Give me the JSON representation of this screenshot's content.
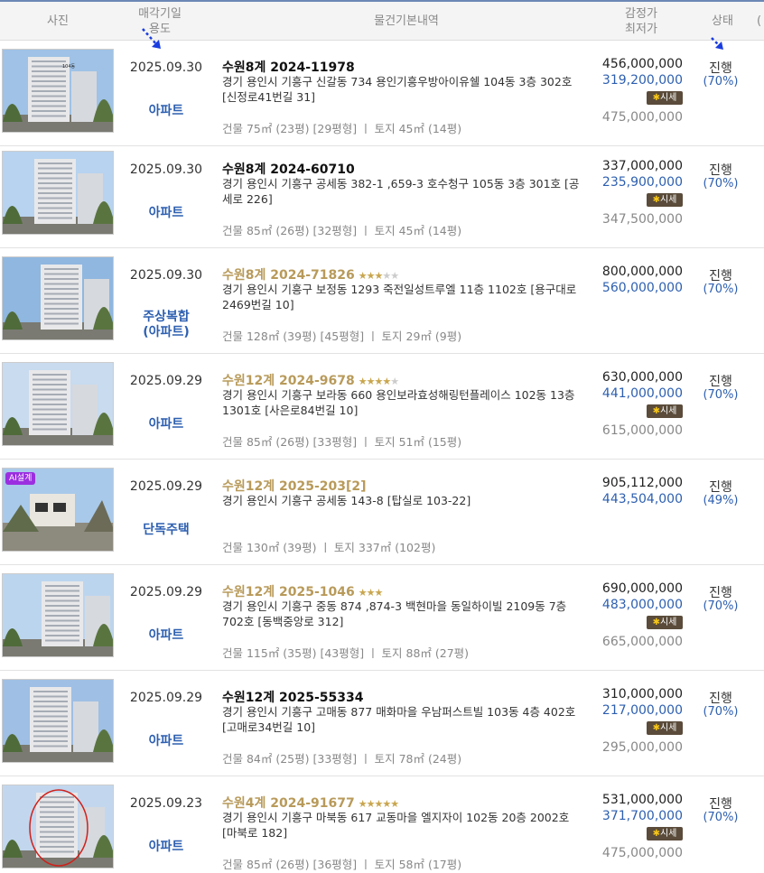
{
  "header": {
    "photo": "사진",
    "date": "매각기일",
    "usage": "용도",
    "info": "물건기본내역",
    "appraisal": "감정가",
    "min_price": "최저가",
    "status": "상태",
    "extra": "("
  },
  "rows": [
    {
      "date": "2025.09.30",
      "usage": "아파트",
      "case": "수원8계 2024-11978",
      "stars": 0,
      "case_style": "plain",
      "address": "경기 용인시 기흥구 신갈동 734 용인기흥우방아이유쉘 104동 3층 302호 [신정로41번길 31]",
      "area": "건물 75㎡ (23평) [29평형]  ㅣ  토지 45㎡ (14평)",
      "appraisal": "456,000,000",
      "min_price": "319,200,000",
      "sise": "시세",
      "market": "475,000,000",
      "status": "진행",
      "pct": "(70%)",
      "photo_label": "104동",
      "badge": ""
    },
    {
      "date": "2025.09.30",
      "usage": "아파트",
      "case": "수원8계 2024-60710",
      "stars": 0,
      "case_style": "plain",
      "address": "경기 용인시 기흥구 공세동 382-1 ,659-3 호수청구 105동 3층 301호 [공세로 226]",
      "area": "건물 85㎡ (26평) [32평형]  ㅣ  토지 45㎡ (14평)",
      "appraisal": "337,000,000",
      "min_price": "235,900,000",
      "sise": "시세",
      "market": "347,500,000",
      "status": "진행",
      "pct": "(70%)",
      "photo_label": "",
      "badge": ""
    },
    {
      "date": "2025.09.30",
      "usage": "주상복합\n(아파트)",
      "case": "수원8계 2024-71826",
      "stars": 3,
      "case_style": "gold",
      "address": "경기 용인시 기흥구 보정동 1293 죽전일성트루엘 11층 1102호 [용구대로2469번길 10]",
      "area": "건물 128㎡ (39평) [45평형]  ㅣ  토지 29㎡ (9평)",
      "appraisal": "800,000,000",
      "min_price": "560,000,000",
      "sise": "",
      "market": "",
      "status": "진행",
      "pct": "(70%)",
      "photo_label": "",
      "badge": ""
    },
    {
      "date": "2025.09.29",
      "usage": "아파트",
      "case": "수원12계 2024-9678",
      "stars": 4,
      "case_style": "gold",
      "address": "경기 용인시 기흥구 보라동 660 용인보라효성해링턴플레이스 102동 13층 1301호 [사은로84번길 10]",
      "area": "건물 85㎡ (26평) [33평형]  ㅣ  토지 51㎡ (15평)",
      "appraisal": "630,000,000",
      "min_price": "441,000,000",
      "sise": "시세",
      "market": "615,000,000",
      "status": "진행",
      "pct": "(70%)",
      "photo_label": "",
      "badge": ""
    },
    {
      "date": "2025.09.29",
      "usage": "단독주택",
      "case": "수원12계 2025-203[2]",
      "stars": 0,
      "case_style": "gold",
      "address": "경기 용인시 기흥구 공세동 143-8 [탑실로 103-22]",
      "area": "건물 130㎡ (39평)  ㅣ  토지 337㎡ (102평)",
      "appraisal": "905,112,000",
      "min_price": "443,504,000",
      "sise": "",
      "market": "",
      "status": "진행",
      "pct": "(49%)",
      "photo_label": "",
      "badge": "AI설계"
    },
    {
      "date": "2025.09.29",
      "usage": "아파트",
      "case": "수원12계 2025-1046",
      "stars": 2.5,
      "case_style": "gold",
      "address": "경기 용인시 기흥구 중동 874 ,874-3 백현마을 동일하이빌 2109동 7층 702호 [동백중앙로 312]",
      "area": "건물 115㎡ (35평) [43평형]  ㅣ  토지 88㎡ (27평)",
      "appraisal": "690,000,000",
      "min_price": "483,000,000",
      "sise": "시세",
      "market": "665,000,000",
      "status": "진행",
      "pct": "(70%)",
      "photo_label": "",
      "badge": ""
    },
    {
      "date": "2025.09.29",
      "usage": "아파트",
      "case": "수원12계 2025-55334",
      "stars": 0,
      "case_style": "plain",
      "address": "경기 용인시 기흥구 고매동 877 매화마을 우남퍼스트빌 103동 4층 402호 [고매로34번길 10]",
      "area": "건물 84㎡ (25평) [33평형]  ㅣ  토지 78㎡ (24평)",
      "appraisal": "310,000,000",
      "min_price": "217,000,000",
      "sise": "시세",
      "market": "295,000,000",
      "status": "진행",
      "pct": "(70%)",
      "photo_label": "",
      "badge": ""
    },
    {
      "date": "2025.09.23",
      "usage": "아파트",
      "case": "수원4계 2024-91677",
      "stars": 5,
      "case_style": "gold",
      "address": "경기 용인시 기흥구 마북동 617 교동마을 엘지자이 102동 20층 2002호 [마북로 182]",
      "area": "건물 85㎡ (26평) [36평형]  ㅣ  토지 58㎡ (17평)",
      "appraisal": "531,000,000",
      "min_price": "371,700,000",
      "sise": "시세",
      "market": "475,000,000",
      "status": "진행",
      "pct": "(70%)",
      "photo_label": "",
      "badge": ""
    }
  ]
}
